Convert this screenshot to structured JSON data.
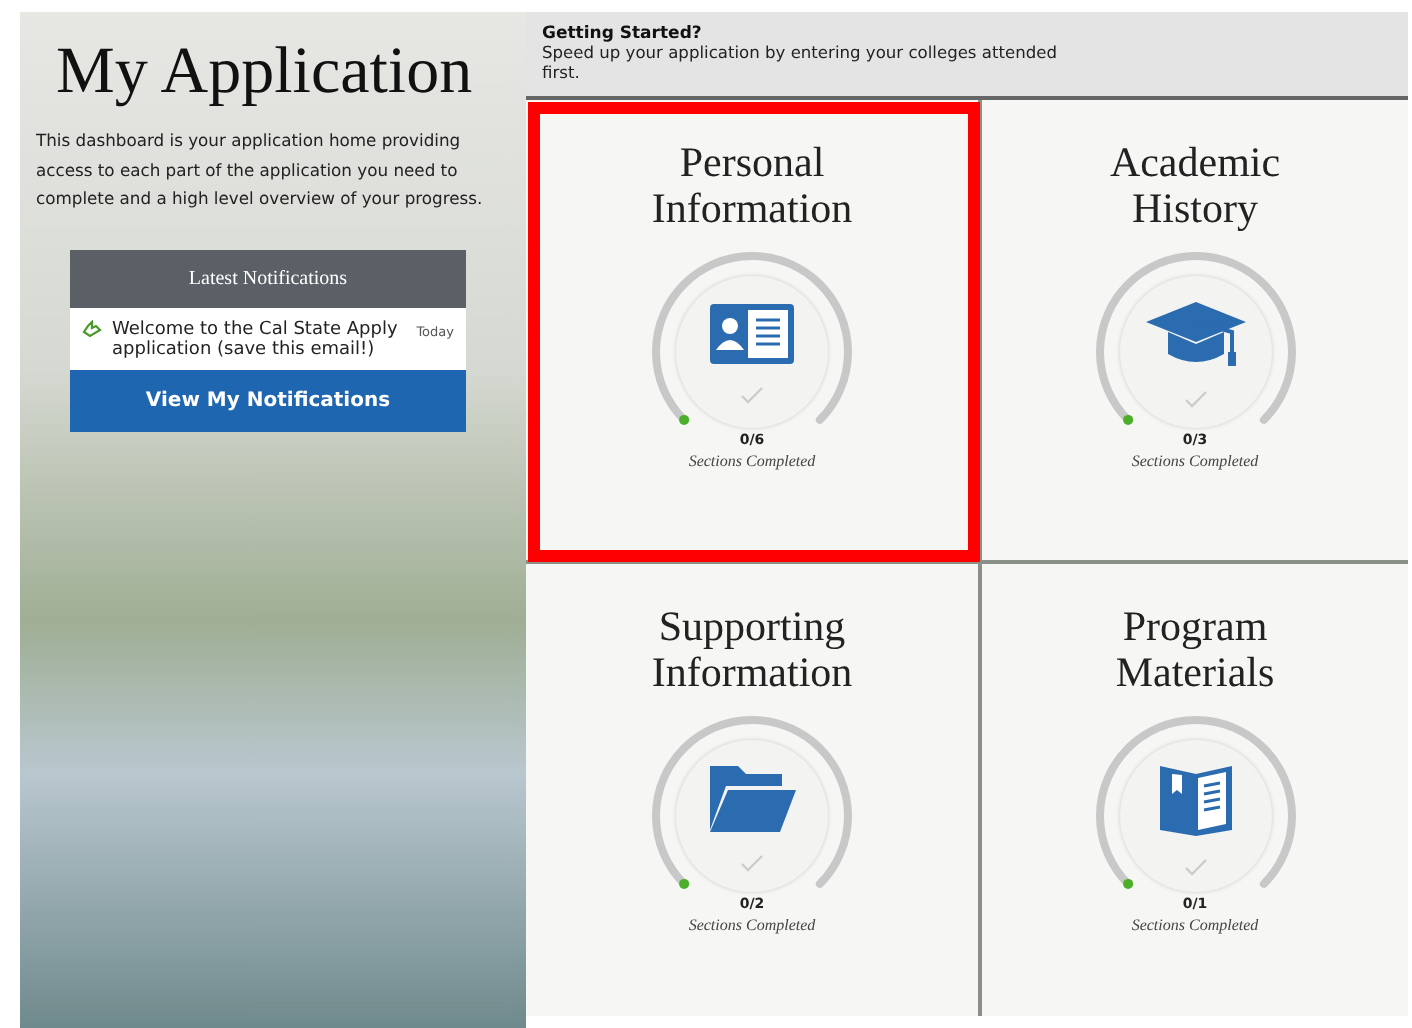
{
  "sidebar": {
    "title": "My Application",
    "description": "This dashboard is your application home providing access to each part of the application you need to complete and a high level overview of your progress.",
    "notifications": {
      "header": "Latest Notifications",
      "items": [
        {
          "text": "Welcome to the Cal State Apply application (save this email!)",
          "time": "Today"
        }
      ],
      "button": "View My Notifications"
    }
  },
  "banner": {
    "title": "Getting Started?",
    "text": "Speed up your application by entering your colleges attended first."
  },
  "tiles": [
    {
      "title": "Personal Information",
      "kind": "id-card",
      "count": "0/6",
      "caption": "Sections Completed",
      "highlighted": true
    },
    {
      "title": "Academic History",
      "kind": "graduation-cap",
      "count": "0/3",
      "caption": "Sections Completed",
      "highlighted": false
    },
    {
      "title": "Supporting Information",
      "kind": "folder",
      "count": "0/2",
      "caption": "Sections Completed",
      "highlighted": false
    },
    {
      "title": "Program Materials",
      "kind": "book",
      "count": "0/1",
      "caption": "Sections Completed",
      "highlighted": false
    }
  ]
}
